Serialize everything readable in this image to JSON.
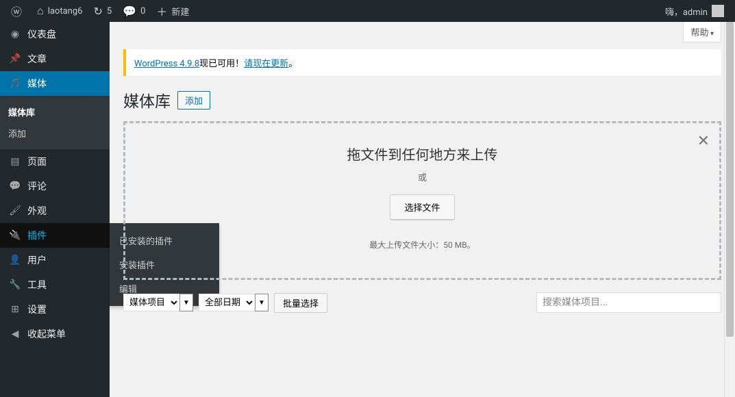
{
  "adminbar": {
    "site_name": "laotang6",
    "refresh_count": "5",
    "comments_count": "0",
    "new_label": "新建",
    "greeting": "嗨，admin"
  },
  "sidebar": {
    "items": [
      {
        "label": "仪表盘",
        "name": "dashboard"
      },
      {
        "label": "文章",
        "name": "posts"
      },
      {
        "label": "媒体",
        "name": "media"
      },
      {
        "label": "页面",
        "name": "pages"
      },
      {
        "label": "评论",
        "name": "comments"
      },
      {
        "label": "外观",
        "name": "appearance"
      },
      {
        "label": "插件",
        "name": "plugins"
      },
      {
        "label": "用户",
        "name": "users"
      },
      {
        "label": "工具",
        "name": "tools"
      },
      {
        "label": "设置",
        "name": "settings"
      },
      {
        "label": "收起菜单",
        "name": "collapse"
      }
    ],
    "media_submenu": [
      {
        "label": "媒体库"
      },
      {
        "label": "添加"
      }
    ],
    "plugins_flyout": [
      {
        "label": "已安装的插件"
      },
      {
        "label": "安装插件"
      },
      {
        "label": "编辑"
      }
    ]
  },
  "content": {
    "help_label": "帮助",
    "notice_version": "WordPress 4.9.8",
    "notice_text1": "现已可用！",
    "notice_link": "请现在更新",
    "notice_text2": "。",
    "page_title": "媒体库",
    "add_button": "添加",
    "dz_title": "拖文件到任何地方来上传",
    "dz_or": "或",
    "dz_button": "选择文件",
    "dz_hint": "最大上传文件大小：50 MB。",
    "filter_type_label": "媒体项目",
    "filter_date_label": "全部日期",
    "bulk_label": "批量选择",
    "search_placeholder": "搜索媒体项目..."
  }
}
